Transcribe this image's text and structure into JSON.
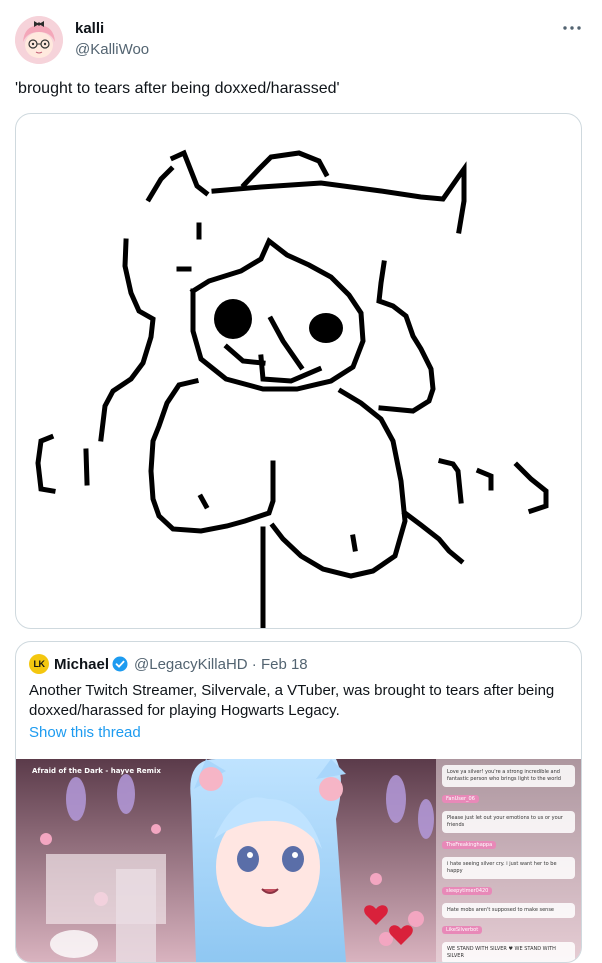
{
  "tweet": {
    "author_name": "kalli",
    "author_handle": "@KalliWoo",
    "text": "'brought to tears after being doxxed/harassed'",
    "more_icon": "more-horizontal-icon"
  },
  "quote": {
    "avatar_initials": "LK",
    "author_name": "Michael",
    "verified_icon": "verified-badge-icon",
    "author_handle": "@LegacyKillaHD",
    "separator": "·",
    "date": "Feb 18",
    "text": "Another Twitch Streamer, Silvervale, a VTuber, was brought to tears after being doxxed/harassed for playing Hogwarts Legacy.",
    "show_thread": "Show this thread",
    "stream_title": "Afraid of the Dark - hayve Remix",
    "chat_tags": [
      "FanUser_06",
      "TheFreakinghappa",
      "sleepytimer0420",
      "LikeSilverbot"
    ],
    "chat_lines": [
      "Love ya silver! you're a strong incredible and fantastic person who brings light to the world",
      "Please just let out your emotions to us or your friends",
      "i hate seeing silver cry. i just want her to be happy",
      "Hate mobs aren't supposed to make sense",
      "WE STAND WITH SILVER ♥ WE STAND WITH SILVER"
    ]
  },
  "colors": {
    "text": "#0f1419",
    "secondary": "#536471",
    "link": "#1d9bf0",
    "border": "#cfd9de",
    "avatar_bg": "#f6d3da",
    "quote_avatar_bg": "#f4c70f"
  }
}
